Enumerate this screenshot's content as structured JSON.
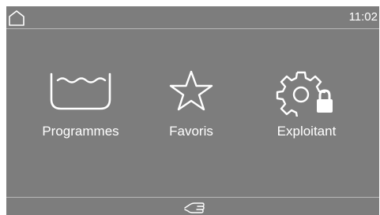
{
  "header": {
    "home_icon": "home-icon",
    "time": "11:02"
  },
  "tiles": [
    {
      "label": "Programmes",
      "icon": "wash-tub-icon"
    },
    {
      "label": "Favoris",
      "icon": "star-icon"
    },
    {
      "label": "Exploitant",
      "icon": "gear-lock-icon"
    }
  ],
  "footer": {
    "icon": "hand-icon"
  },
  "colors": {
    "screen_background": "#7d7d7d",
    "foreground": "#ffffff",
    "divider": "#b8b8b8"
  }
}
